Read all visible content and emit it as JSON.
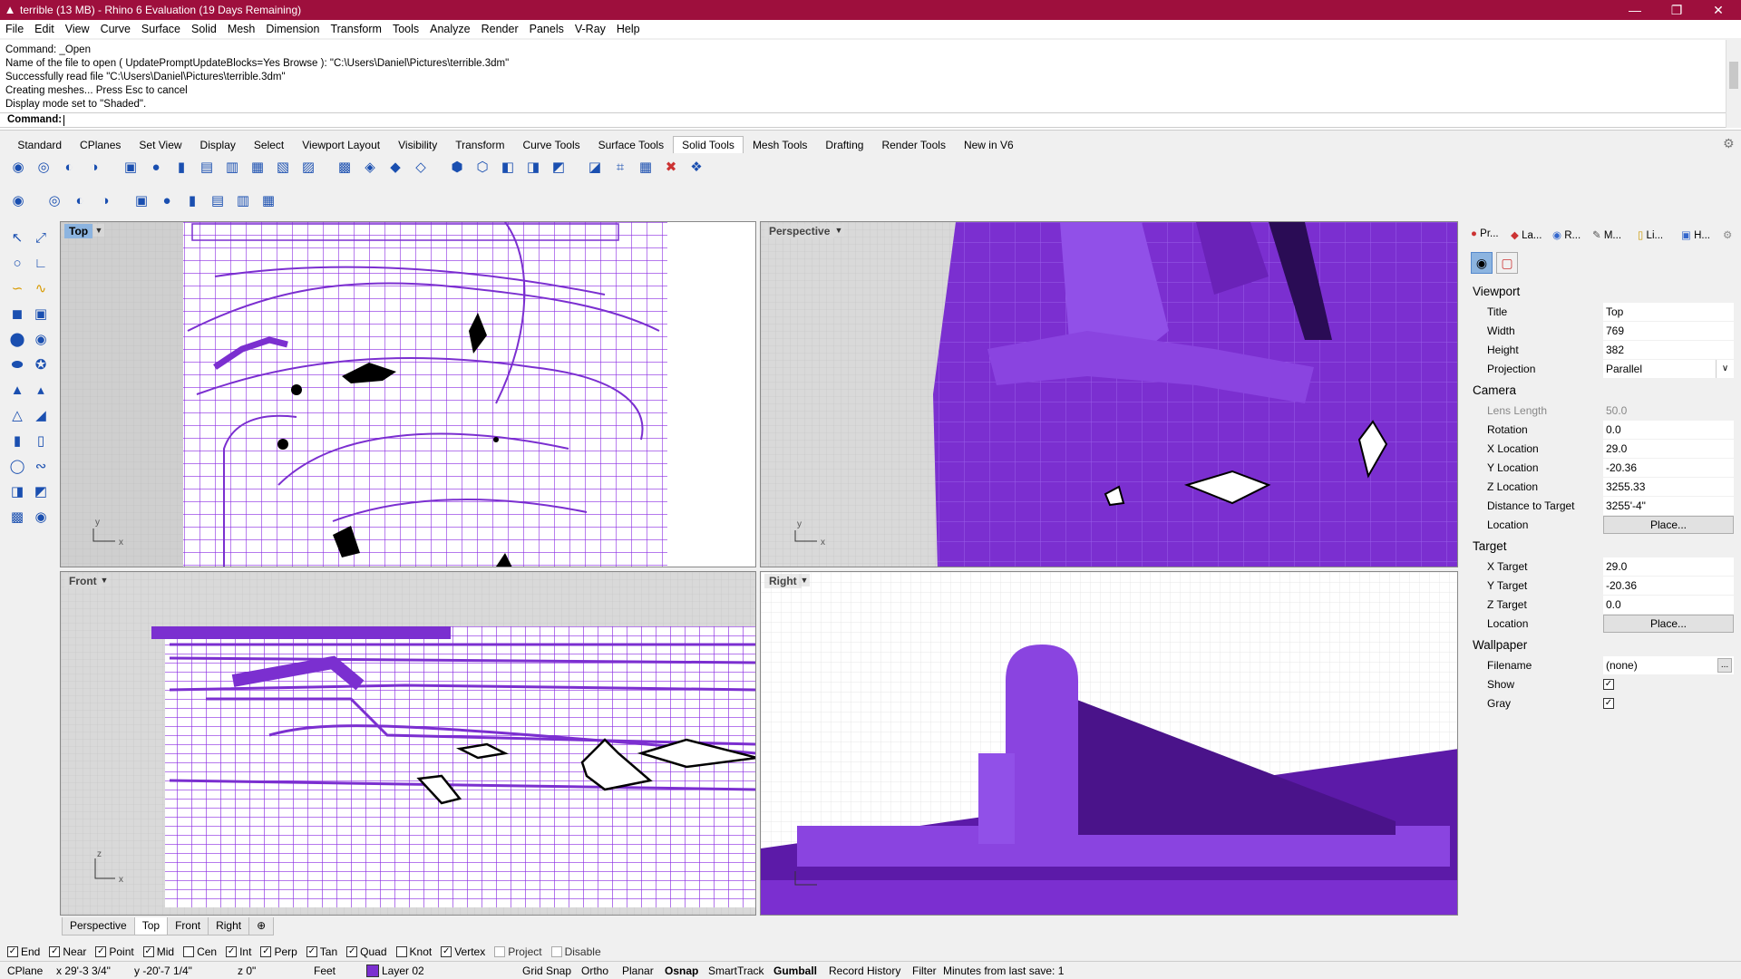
{
  "window": {
    "title": "terrible (13 MB) - Rhino 6 Evaluation (19 Days Remaining)",
    "minimize": "—",
    "restore": "❐",
    "close": "✕"
  },
  "menu": [
    "File",
    "Edit",
    "View",
    "Curve",
    "Surface",
    "Solid",
    "Mesh",
    "Dimension",
    "Transform",
    "Tools",
    "Analyze",
    "Render",
    "Panels",
    "V-Ray",
    "Help"
  ],
  "command": {
    "history": [
      "Command: _Open",
      "Name of the file to open ( UpdatePromptUpdateBlocks=Yes  Browse ): \"C:\\Users\\Daniel\\Pictures\\terrible.3dm\"",
      "Successfully read file \"C:\\Users\\Daniel\\Pictures\\terrible.3dm\"",
      "Creating meshes... Press Esc to cancel",
      "Display mode set to \"Shaded\"."
    ],
    "prompt": "Command:"
  },
  "toolbar_tabs": [
    "Standard",
    "CPlanes",
    "Set View",
    "Display",
    "Select",
    "Viewport Layout",
    "Visibility",
    "Transform",
    "Curve Tools",
    "Surface Tools",
    "Solid Tools",
    "Mesh Tools",
    "Drafting",
    "Render Tools",
    "New in V6"
  ],
  "active_toolbar_tab": "Solid Tools",
  "viewports": {
    "top": "Top",
    "perspective": "Perspective",
    "front": "Front",
    "right": "Right",
    "axis_x": "x",
    "axis_y": "y",
    "axis_z": "z"
  },
  "viewport_tabs": [
    "Perspective",
    "Top",
    "Front",
    "Right",
    "⊕"
  ],
  "active_viewport_tab": "Top",
  "panel": {
    "tabs": [
      "Pr...",
      "La...",
      "R...",
      "M...",
      "Li...",
      "H..."
    ],
    "sections": {
      "viewport": "Viewport",
      "camera": "Camera",
      "target": "Target",
      "wallpaper": "Wallpaper"
    },
    "viewport": {
      "title_label": "Title",
      "title": "Top",
      "width_label": "Width",
      "width": "769",
      "height_label": "Height",
      "height": "382",
      "projection_label": "Projection",
      "projection": "Parallel"
    },
    "camera": {
      "lens_label": "Lens Length",
      "lens": "50.0",
      "rotation_label": "Rotation",
      "rotation": "0.0",
      "xloc_label": "X Location",
      "xloc": "29.0",
      "yloc_label": "Y Location",
      "yloc": "-20.36",
      "zloc_label": "Z Location",
      "zloc": "3255.33",
      "dist_label": "Distance to Target",
      "dist": "3255'-4\"",
      "loc_label": "Location",
      "loc_button": "Place..."
    },
    "target": {
      "x_label": "X Target",
      "x": "29.0",
      "y_label": "Y Target",
      "y": "-20.36",
      "z_label": "Z Target",
      "z": "0.0",
      "loc_label": "Location",
      "loc_button": "Place..."
    },
    "wallpaper": {
      "filename_label": "Filename",
      "filename": "(none)",
      "browse": "...",
      "show_label": "Show",
      "gray_label": "Gray"
    }
  },
  "osnaps": [
    {
      "label": "End",
      "checked": true
    },
    {
      "label": "Near",
      "checked": true
    },
    {
      "label": "Point",
      "checked": true
    },
    {
      "label": "Mid",
      "checked": true
    },
    {
      "label": "Cen",
      "checked": false
    },
    {
      "label": "Int",
      "checked": true
    },
    {
      "label": "Perp",
      "checked": true
    },
    {
      "label": "Tan",
      "checked": true
    },
    {
      "label": "Quad",
      "checked": true
    },
    {
      "label": "Knot",
      "checked": false
    },
    {
      "label": "Vertex",
      "checked": true
    },
    {
      "label": "Project",
      "checked": false,
      "disabled": true
    },
    {
      "label": "Disable",
      "checked": false,
      "disabled": true
    }
  ],
  "status": {
    "cplane": "CPlane",
    "x": "x 29'-3 3/4\"",
    "y": "y -20'-7 1/4\"",
    "z": "z 0\"",
    "units": "Feet",
    "layer": "Layer 02",
    "layer_color": "#7b2fd0",
    "grid_snap": "Grid Snap",
    "ortho": "Ortho",
    "planar": "Planar",
    "osnap": "Osnap",
    "smarttrack": "SmartTrack",
    "gumball": "Gumball",
    "record_history": "Record History",
    "filter": "Filter",
    "save_info": "Minutes from last save: 1"
  },
  "colors": {
    "titlebar": "#9e0f3d",
    "model_purple": "#7b2fd0",
    "wire_purple": "#8a2be2"
  },
  "icons": {
    "toolrow1": [
      "boolean-union-icon",
      "boolean-difference-icon",
      "boolean-intersection-icon",
      "boolean-split-icon",
      "box-icon",
      "sphere-icon",
      "cylinder-icon",
      "extrude-icon",
      "cap-icon",
      "fillet-edge-icon",
      "shell-icon",
      "wirecut-icon",
      "solid-edit-icon",
      "move-face-icon",
      "move-edge-icon",
      "split-face-icon",
      "merge-face-icon",
      "extract-icon",
      "rebuild-icon",
      "history-icon",
      "text-object-icon",
      "solid-points-icon",
      "grid-icon",
      "mesh-grid-icon",
      "delete-face-icon",
      "properties-icon"
    ],
    "toolrow2": [
      "check-icon",
      "analyze-icon",
      "match-icon",
      "boundary-icon",
      "network-icon",
      "flow-icon",
      "pipe-icon",
      "loft-icon",
      "sweep-icon",
      "rail-icon"
    ]
  }
}
